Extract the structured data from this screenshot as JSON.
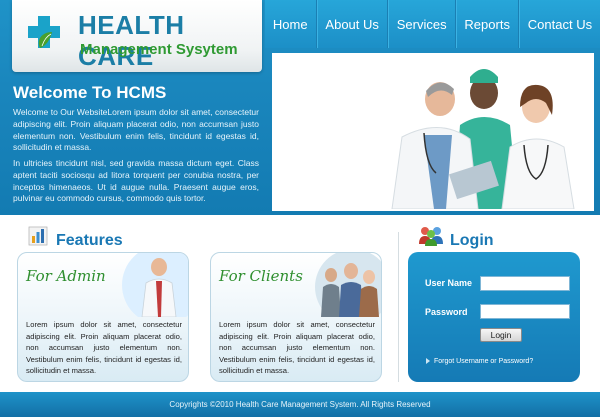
{
  "logo": {
    "title": "HEALTH CARE",
    "subtitle": "Management Sysytem"
  },
  "nav": {
    "items": [
      "Home",
      "About Us",
      "Services",
      "Reports",
      "Contact Us"
    ]
  },
  "welcome": {
    "title": "Welcome To HCMS",
    "paragraph1": "Welcome to Our WebsiteLorem ipsum dolor sit amet, consectetur adipiscing elit. Proin aliquam placerat odio, non accumsan justo elementum non. Vestibulum enim felis, tincidunt id egestas id, sollicitudin et massa.",
    "paragraph2": "In ultricies tincidunt nisl, sed gravida massa dictum eget. Class aptent taciti sociosqu ad litora torquent per conubia nostra, per inceptos himenaeos. Ut id augue nulla. Praesent augue eros, pulvinar eu commodo cursus, commodo quis tortor."
  },
  "features": {
    "title": "Features",
    "cards": [
      {
        "title": "For Admin",
        "text": "Lorem ipsum dolor sit amet, consectetur adipiscing elit. Proin aliquam placerat odio, non accumsan justo elementum non. Vestibulum enim felis, tincidunt id egestas id, sollicitudin et massa."
      },
      {
        "title": "For Clients",
        "text": "Lorem ipsum dolor sit amet, consectetur adipiscing elit. Proin aliquam placerat odio, non accumsan justo elementum non. Vestibulum enim felis, tincidunt id egestas id, sollicitudin et massa."
      }
    ]
  },
  "login": {
    "title": "Login",
    "username_label": "User Name",
    "password_label": "Password",
    "button_label": "Login",
    "forgot_text": "Forgot Username or Password?"
  },
  "footer": {
    "text": "Copyrights ©2010 Health Care Management System. All Rights Reserved"
  },
  "colors": {
    "header_blue": "#1a86bd",
    "title_blue": "#1a78b4",
    "green": "#2f9a33"
  }
}
